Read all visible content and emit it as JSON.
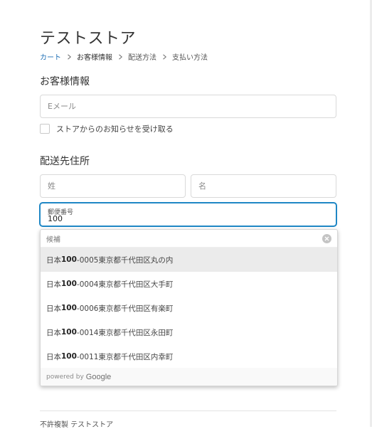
{
  "store": {
    "title": "テストストア"
  },
  "breadcrumb": [
    {
      "label": "カート",
      "state": "link"
    },
    {
      "label": "お客様情報",
      "state": "current"
    },
    {
      "label": "配送方法",
      "state": "upcoming"
    },
    {
      "label": "支払い方法",
      "state": "upcoming"
    }
  ],
  "customer": {
    "section_title": "お客様情報",
    "email_placeholder": "Eメール",
    "email_value": "",
    "newsletter_label": "ストアからのお知らせを受け取る",
    "newsletter_checked": false
  },
  "shipping": {
    "section_title": "配送先住所",
    "last_name_placeholder": "姓",
    "first_name_placeholder": "名",
    "postal_label": "郵便番号",
    "postal_value": "100"
  },
  "autocomplete": {
    "header_label": "候補",
    "suggestions": [
      {
        "prefix": "日本",
        "match": "100",
        "rest": "-0005東京都千代田区丸の内",
        "highlighted": true
      },
      {
        "prefix": "日本",
        "match": "100",
        "rest": "-0004東京都千代田区大手町",
        "highlighted": false
      },
      {
        "prefix": "日本",
        "match": "100",
        "rest": "-0006東京都千代田区有楽町",
        "highlighted": false
      },
      {
        "prefix": "日本",
        "match": "100",
        "rest": "-0014東京都千代田区永田町",
        "highlighted": false
      },
      {
        "prefix": "日本",
        "match": "100",
        "rest": "-0011東京都千代田区内幸町",
        "highlighted": false
      }
    ],
    "powered_by": "powered by",
    "provider": "Google"
  },
  "footer": {
    "text": "不許複製 テストストア"
  },
  "colors": {
    "link": "#1f6fb5",
    "focus": "#1f87c5",
    "highlight": "#ebebeb"
  }
}
